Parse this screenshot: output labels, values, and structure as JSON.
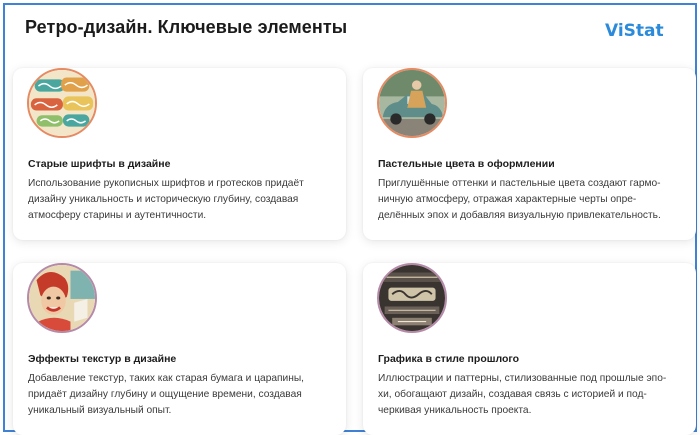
{
  "page": {
    "title": "Ретро-дизайн. Ключевые элементы",
    "logo_text": "ViStat",
    "accent_color": "#3f82d6"
  },
  "cards": [
    {
      "title": "Старые шрифты в дизайне",
      "lines": [
        "Использование рукописных шрифтов и гротесков придаёт",
        "дизайну уникальность и историческую глубину, создавая",
        "атмосферу старины и аутентичности."
      ],
      "image_icon": "retro-lettering-icon"
    },
    {
      "title": "Пастельные цвета в оформлении",
      "lines": [
        "Приглушённые оттенки и пастельные цвета создают гармо-",
        "ничную атмосферу, отражая характерные черты опре-",
        "делённых эпох и добавляя визуальную привлекательность."
      ],
      "image_icon": "vintage-car-icon"
    },
    {
      "title": "Эффекты текстур в дизайне",
      "lines": [
        "Добавление текстур, таких как старая бумага и царапины,",
        "придаёт дизайну глубину и ощущение времени, создавая",
        "уникальный визуальный опыт."
      ],
      "image_icon": "pinup-poster-icon"
    },
    {
      "title": "Графика в стиле прошлого",
      "lines": [
        "Иллюстрации и паттерны, стилизованные под прошлые эпо-",
        "хи, обогащают дизайн, создавая связь с историей и под-",
        "черкивая уникальность проекта."
      ],
      "image_icon": "victorian-typography-icon"
    }
  ]
}
